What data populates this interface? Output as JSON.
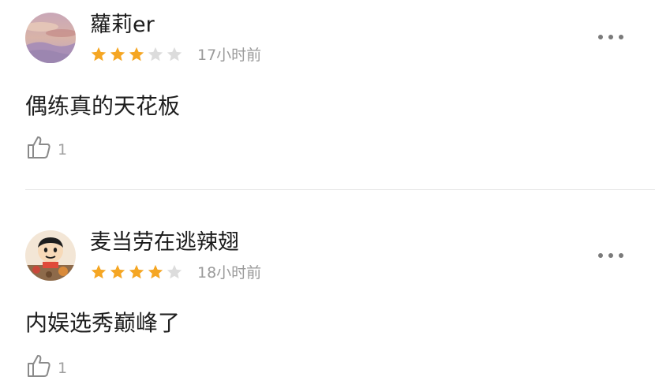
{
  "comments": [
    {
      "username": "蘿莉er",
      "rating": 3,
      "max_rating": 5,
      "time": "17小时前",
      "text": "偶练真的天花板",
      "likes": "1",
      "avatar_icon": "landscape-avatar"
    },
    {
      "username": "麦当劳在逃辣翅",
      "rating": 4,
      "max_rating": 5,
      "time": "18小时前",
      "text": "内娱选秀巅峰了",
      "likes": "1",
      "avatar_icon": "cartoon-boy-avatar"
    }
  ],
  "icons": {
    "more": "more-options-icon",
    "like": "thumbs-up-icon",
    "star": "star-icon"
  },
  "colors": {
    "star_filled": "#F5A623",
    "star_empty": "#DCDCDC",
    "time_text": "#9A9A9A",
    "divider": "#E6E6E6"
  }
}
